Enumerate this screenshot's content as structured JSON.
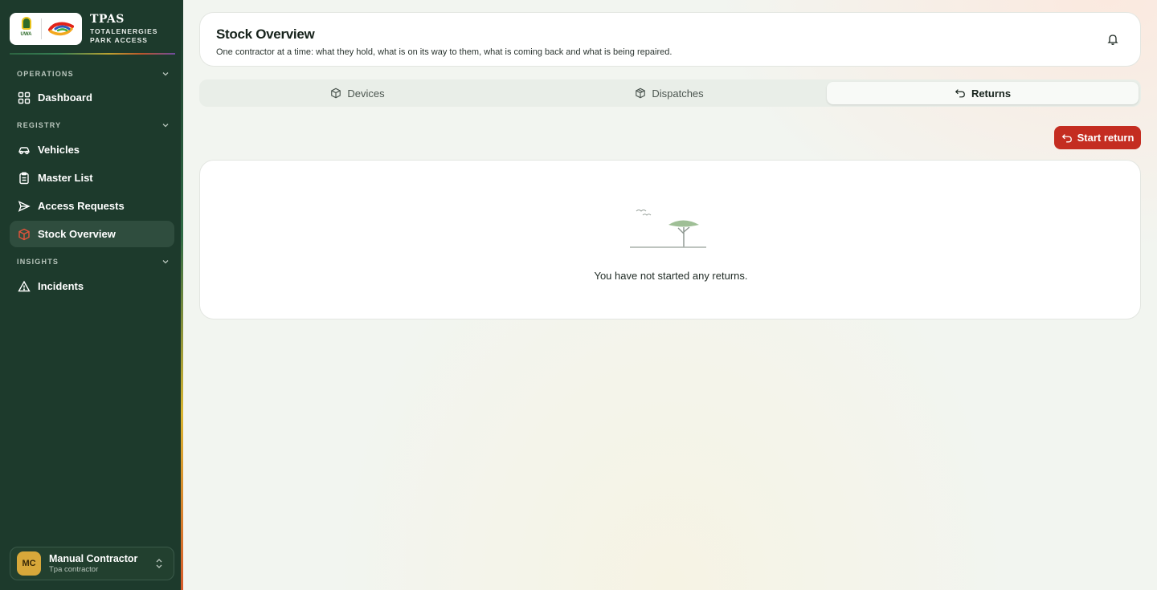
{
  "brand": {
    "title": "TPAS",
    "subtitle_line1": "TOTALENERGIES",
    "subtitle_line2": "PARK ACCESS",
    "uwa_logo_text": "UWA"
  },
  "sidebar": {
    "sections": [
      {
        "label": "OPERATIONS",
        "items": [
          {
            "label": "Dashboard",
            "icon": "dashboard-grid-icon"
          }
        ]
      },
      {
        "label": "REGISTRY",
        "items": [
          {
            "label": "Vehicles",
            "icon": "car-icon"
          },
          {
            "label": "Master List",
            "icon": "clipboard-icon"
          },
          {
            "label": "Access Requests",
            "icon": "send-icon"
          },
          {
            "label": "Stock Overview",
            "icon": "box-icon",
            "active": true
          }
        ]
      },
      {
        "label": "INSIGHTS",
        "items": [
          {
            "label": "Incidents",
            "icon": "warning-triangle-icon"
          }
        ]
      }
    ]
  },
  "user": {
    "initials": "MC",
    "name": "Manual Contractor",
    "role": "Tpa contractor"
  },
  "header": {
    "title": "Stock Overview",
    "subtitle": "One contractor at a time: what they hold, what is on its way to them, what is coming back and what is being repaired."
  },
  "tabs": [
    {
      "label": "Devices",
      "icon": "box-icon"
    },
    {
      "label": "Dispatches",
      "icon": "box-icon"
    },
    {
      "label": "Returns",
      "icon": "undo-icon",
      "active": true
    }
  ],
  "actions": {
    "start_return_label": "Start return"
  },
  "empty_state": {
    "message": "You have not started any returns."
  },
  "colors": {
    "sidebar_bg": "#1d3a2c",
    "accent_red": "#c42d21",
    "active_nav_bg": "#2f4d3e",
    "avatar_bg": "#d8a83a"
  }
}
